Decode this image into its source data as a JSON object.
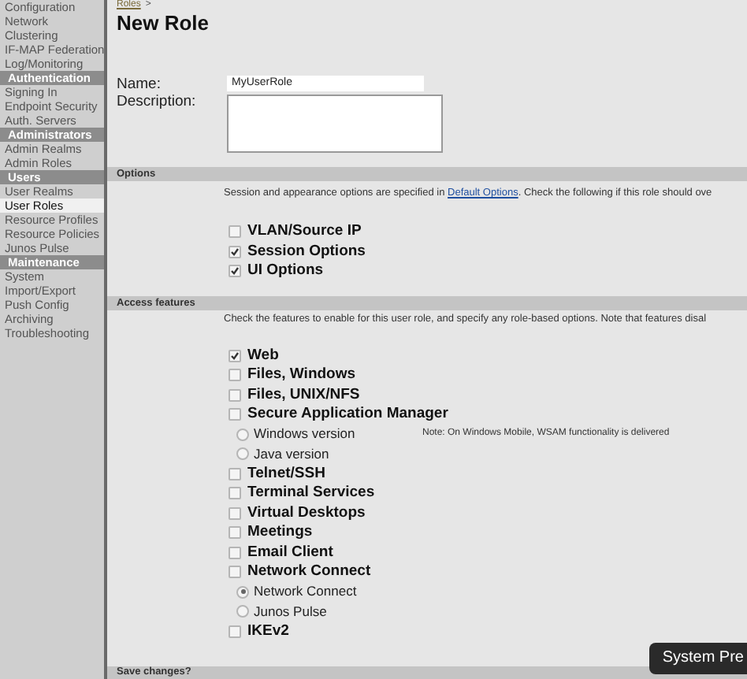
{
  "sidebar": {
    "items": [
      {
        "label": "Configuration",
        "kind": "item",
        "selected": false
      },
      {
        "label": "Network",
        "kind": "item",
        "selected": false
      },
      {
        "label": "Clustering",
        "kind": "item",
        "selected": false
      },
      {
        "label": "IF-MAP Federation",
        "kind": "item",
        "selected": false
      },
      {
        "label": "Log/Monitoring",
        "kind": "item",
        "selected": false
      },
      {
        "label": "Authentication",
        "kind": "header"
      },
      {
        "label": "Signing In",
        "kind": "item",
        "selected": false
      },
      {
        "label": "Endpoint Security",
        "kind": "item",
        "selected": false
      },
      {
        "label": "Auth. Servers",
        "kind": "item",
        "selected": false
      },
      {
        "label": "Administrators",
        "kind": "header"
      },
      {
        "label": "Admin Realms",
        "kind": "item",
        "selected": false
      },
      {
        "label": "Admin Roles",
        "kind": "item",
        "selected": false
      },
      {
        "label": "Users",
        "kind": "header"
      },
      {
        "label": "User Realms",
        "kind": "item",
        "selected": false
      },
      {
        "label": "User Roles",
        "kind": "item",
        "selected": true
      },
      {
        "label": "Resource Profiles",
        "kind": "item",
        "selected": false
      },
      {
        "label": "Resource Policies",
        "kind": "item",
        "selected": false
      },
      {
        "label": "Junos Pulse",
        "kind": "item",
        "selected": false
      },
      {
        "label": "Maintenance",
        "kind": "header"
      },
      {
        "label": "System",
        "kind": "item",
        "selected": false
      },
      {
        "label": "Import/Export",
        "kind": "item",
        "selected": false
      },
      {
        "label": "Push Config",
        "kind": "item",
        "selected": false
      },
      {
        "label": "Archiving",
        "kind": "item",
        "selected": false
      },
      {
        "label": "Troubleshooting",
        "kind": "item",
        "selected": false
      }
    ]
  },
  "breadcrumb": {
    "link": "Roles",
    "separator": ">"
  },
  "page_title": "New Role",
  "form": {
    "name_label": "Name:",
    "name_value": "MyUserRole",
    "description_label": "Description:"
  },
  "options": {
    "title": "Options",
    "text_before": "Session and appearance options are specified in ",
    "link": "Default Options",
    "text_after": ". Check the following if this role should ove",
    "items": [
      {
        "label": "VLAN/Source IP",
        "checked": false
      },
      {
        "label": "Session Options",
        "checked": true
      },
      {
        "label": "UI Options",
        "checked": true
      }
    ]
  },
  "access_features": {
    "title": "Access features",
    "text": "Check the features to enable for this user role, and specify any role-based options. Note that features disal",
    "items": [
      {
        "label": "Web",
        "checked": true
      },
      {
        "label": "Files, Windows",
        "checked": false
      },
      {
        "label": "Files, UNIX/NFS",
        "checked": false
      },
      {
        "label": "Secure Application Manager",
        "checked": false,
        "children": [
          {
            "label": "Windows version",
            "selected": false,
            "note": "Note: On Windows Mobile, WSAM functionality is delivered"
          },
          {
            "label": "Java version",
            "selected": false
          }
        ]
      },
      {
        "label": "Telnet/SSH",
        "checked": false
      },
      {
        "label": "Terminal Services",
        "checked": false
      },
      {
        "label": "Virtual Desktops",
        "checked": false
      },
      {
        "label": "Meetings",
        "checked": false
      },
      {
        "label": "Email Client",
        "checked": false
      },
      {
        "label": "Network Connect",
        "checked": false,
        "children": [
          {
            "label": "Network Connect",
            "selected": true
          },
          {
            "label": "Junos Pulse",
            "selected": false
          }
        ]
      },
      {
        "label": "IKEv2",
        "checked": false
      }
    ]
  },
  "save_bar": {
    "title": "Save changes?"
  },
  "tooltip": {
    "text": "System Pre"
  }
}
